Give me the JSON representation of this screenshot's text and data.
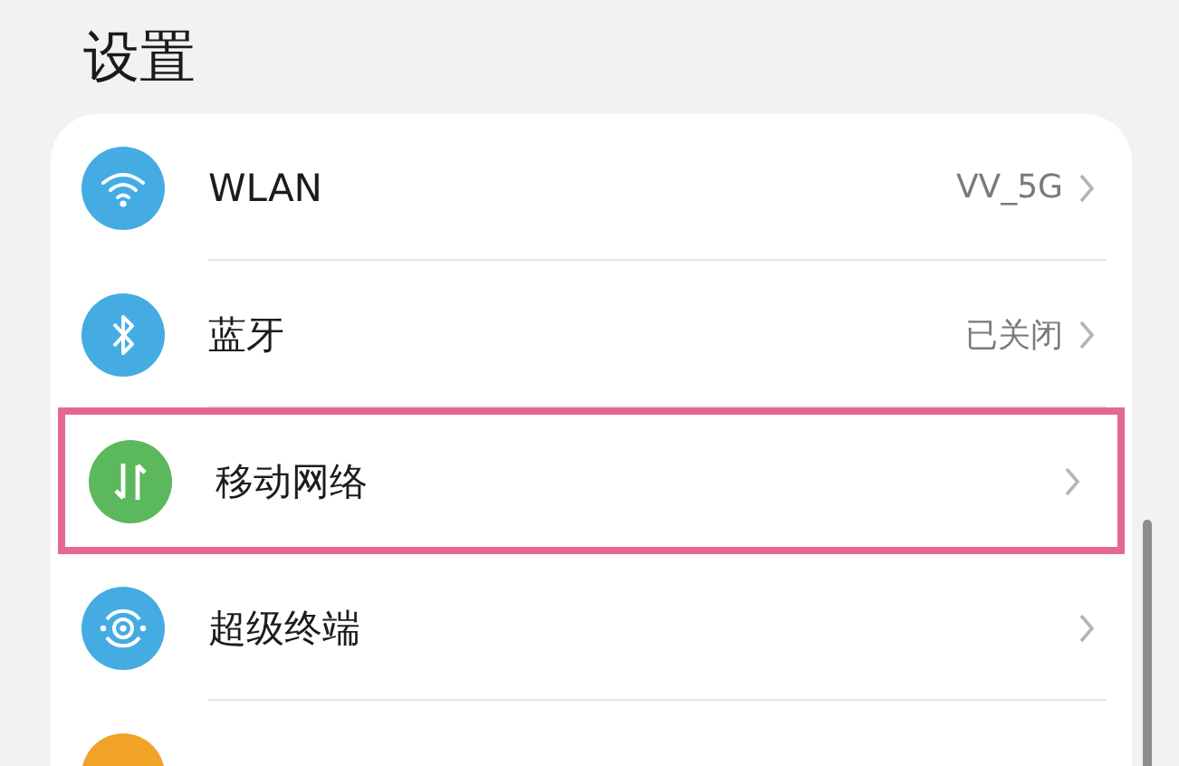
{
  "title": "设置",
  "items": [
    {
      "kind": "wifi",
      "label": "WLAN",
      "value": "VV_5G",
      "color": "#45ace3",
      "highlighted": false
    },
    {
      "kind": "bluetooth",
      "label": "蓝牙",
      "value": "已关闭",
      "color": "#45ace3",
      "highlighted": false
    },
    {
      "kind": "data",
      "label": "移动网络",
      "color": "#5cb85c",
      "highlighted": true
    },
    {
      "kind": "devices",
      "label": "超级终端",
      "color": "#45ace3",
      "highlighted": false
    },
    {
      "kind": "other",
      "color": "#f0a326",
      "highlighted": false
    }
  ]
}
